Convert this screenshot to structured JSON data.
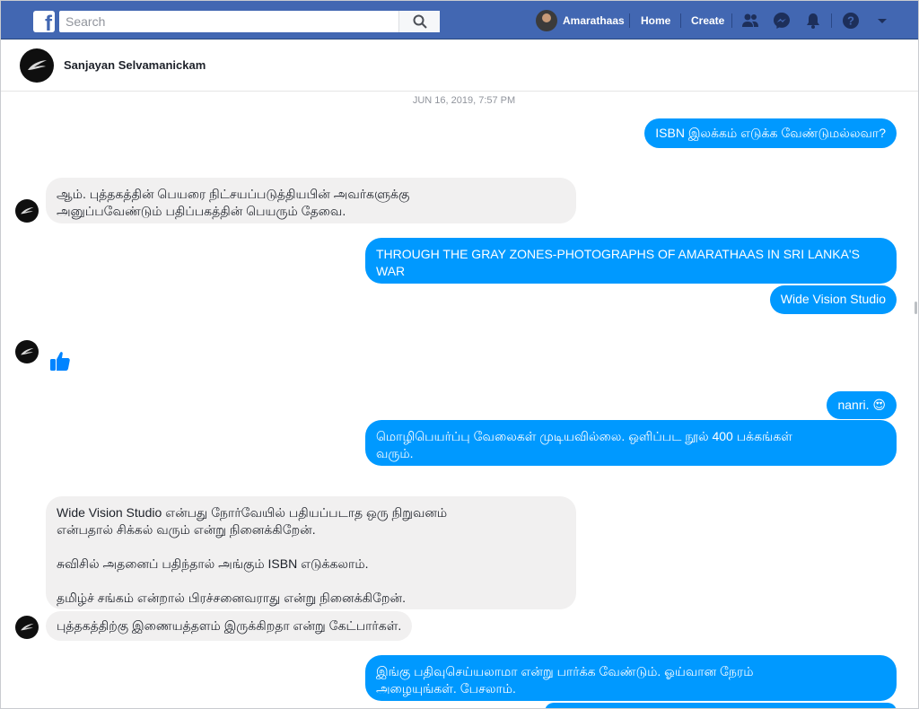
{
  "topbar": {
    "search_placeholder": "Search",
    "user_name": "Amarathaas",
    "home_label": "Home",
    "create_label": "Create"
  },
  "chat": {
    "contact_name": "Sanjayan Selvamanickam",
    "timestamp": "JUN 16, 2019, 7:57 PM"
  },
  "messages": [
    {
      "from": "me",
      "text": "ISBN இலக்கம் எடுக்க வேண்டுமல்லவா?"
    },
    {
      "from": "them",
      "text": "ஆம். புத்தகத்தின் பெயரை நிட்சயப்படுத்தியபின் அவர்களுக்கு\nஅனுப்பவேண்டும் பதிப்பகத்தின் பெயரும் தேவை."
    },
    {
      "from": "me",
      "text": "THROUGH THE GRAY ZONES-PHOTOGRAPHS OF AMARATHAAS IN SRI LANKA'S WAR\nZONES"
    },
    {
      "from": "me",
      "text": "Wide Vision Studio"
    },
    {
      "from": "them",
      "text": ""
    },
    {
      "from": "me",
      "text": "nanri. 😍"
    },
    {
      "from": "me",
      "text": "மொழிபெயர்ப்பு வேலைகள் முடியவில்லை. ஒளிப்பட நூல் 400 பக்கங்கள்\nவரும்."
    },
    {
      "from": "them",
      "text": "Wide Vision Studio  என்பது நோர்வேயில் பதியப்படாத ஒரு நிறுவனம்\nஎன்பதால் சிக்கல் வரும் என்று நினைக்கிறேன்.\n\nசுவிசில் அதனைப் பதிந்தால் அங்கும் ISBN எடுக்கலாம்.\n\nதமிழ்ச் சங்கம் என்றால் பிரச்சனைவராது என்று நினைக்கிறேன்."
    },
    {
      "from": "them",
      "text": "புத்தகத்திற்கு இணையத்தளம் இருக்கிறதா என்று கேட்பார்கள்."
    },
    {
      "from": "me",
      "text": "இங்கு பதிவுசெய்யலாமா என்று பார்க்க வேண்டும்.  ஓய்வான நேரம்\nஅழையுங்கள். பேசலாம்."
    }
  ],
  "colors": {
    "brand": "#4267b2",
    "outgoing_bubble": "#0099ff",
    "incoming_bubble": "#f1f0f0"
  }
}
